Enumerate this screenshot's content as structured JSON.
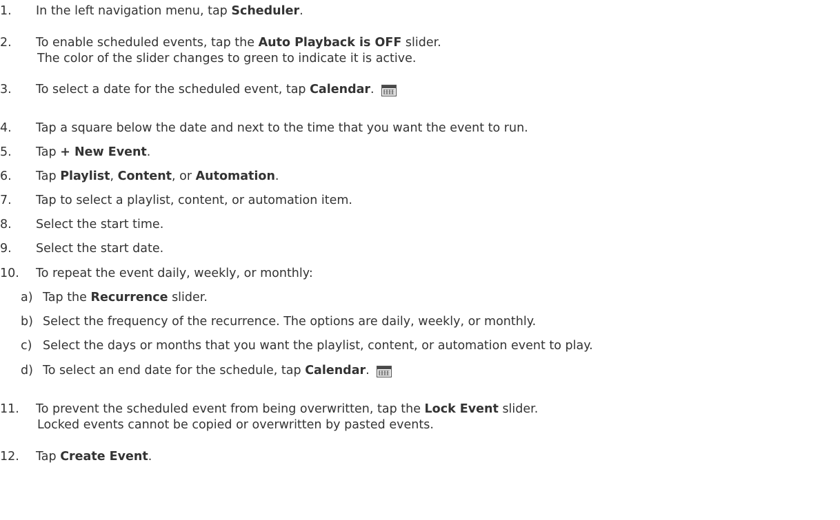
{
  "steps": [
    {
      "n": "1.",
      "pre": "In the left navigation menu, tap ",
      "b1": "Scheduler",
      "post": "."
    },
    {
      "n": "2.",
      "pre": "To enable scheduled events, tap the ",
      "b1": "Auto Playback is OFF",
      "post": " slider.",
      "l2": "The color of the slider changes to green to indicate it is active."
    },
    {
      "n": "3.",
      "pre": "To select a date for the scheduled event, tap ",
      "b1": "Calendar",
      "post": ".",
      "icon": "calendar-icon"
    },
    {
      "n": "4.",
      "pre": "Tap a square below the date and next to the time that you want the event to run."
    },
    {
      "n": "5.",
      "pre": "Tap ",
      "b1": "+ New Event",
      "post": "."
    },
    {
      "n": "6.",
      "pre": "Tap ",
      "b1": "Playlist",
      "mid1": ", ",
      "b2": "Content",
      "mid2": ", or ",
      "b3": "Automation",
      "post": "."
    },
    {
      "n": "7.",
      "pre": "Tap to select a playlist, content, or automation item."
    },
    {
      "n": "8.",
      "pre": "Select the start time."
    },
    {
      "n": "9.",
      "pre": "Select the start date."
    },
    {
      "n": "10.",
      "pre": "To repeat the event daily, weekly, or monthly:"
    },
    {
      "n": "11.",
      "pre": "To prevent the scheduled event from being overwritten, tap the ",
      "b1": "Lock Event",
      "post": " slider.",
      "l2": "Locked events cannot be copied or overwritten by pasted events."
    },
    {
      "n": "12.",
      "pre": "Tap ",
      "b1": "Create Event",
      "post": "."
    }
  ],
  "substeps": [
    {
      "n": "a)",
      "pre": "Tap the ",
      "b1": "Recurrence",
      "post": " slider."
    },
    {
      "n": "b)",
      "pre": "Select the frequency of the recurrence. The options are daily, weekly, or monthly."
    },
    {
      "n": "c)",
      "pre": "Select the days or months that you want the playlist, content, or automation event to play."
    },
    {
      "n": "d)",
      "pre": "To select an end date for the schedule, tap ",
      "b1": "Calendar",
      "post": ".",
      "icon": "calendar-icon"
    }
  ]
}
